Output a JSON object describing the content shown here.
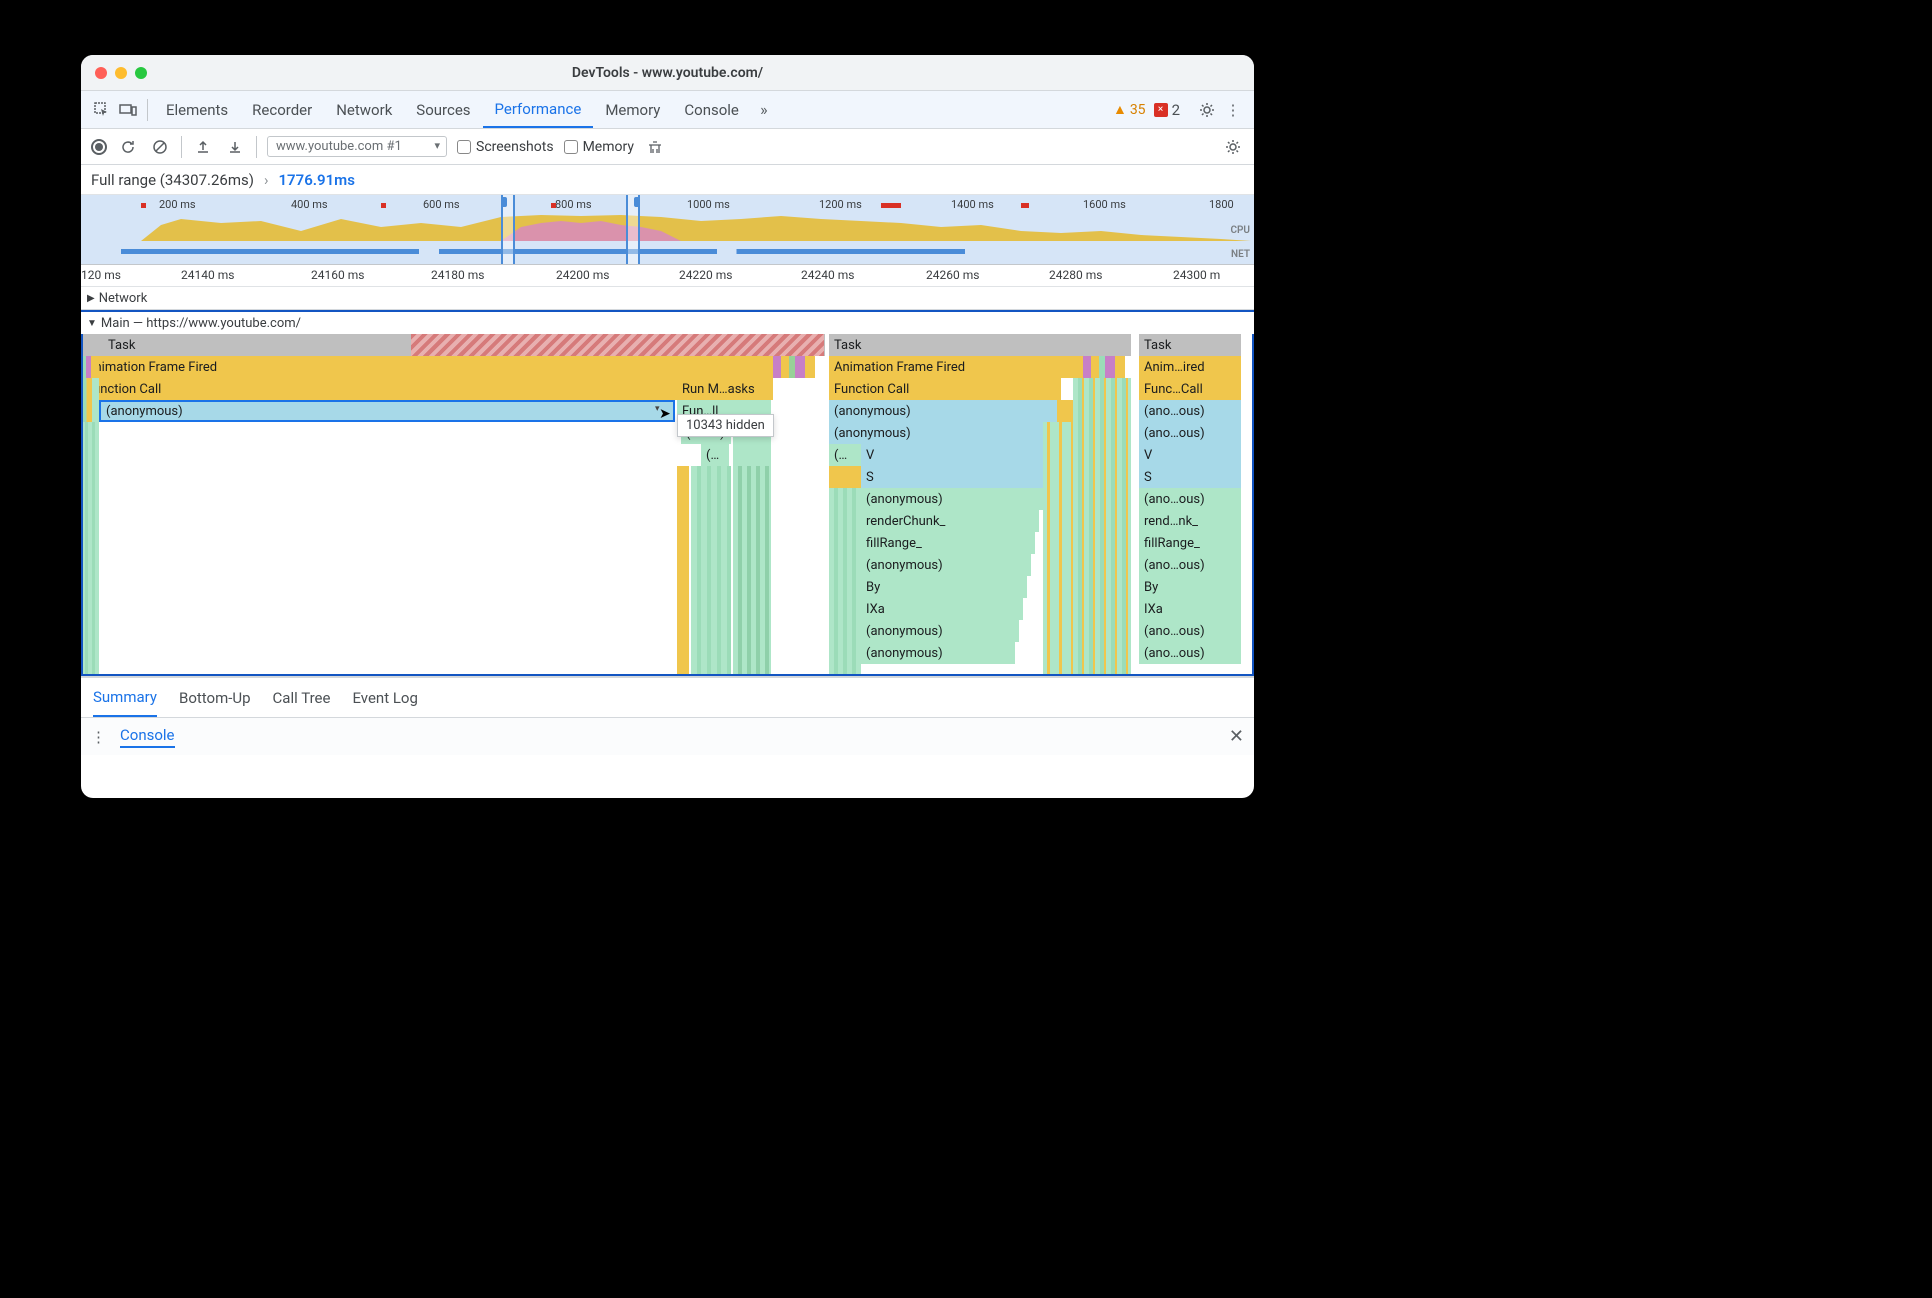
{
  "window": {
    "title": "DevTools - www.youtube.com/"
  },
  "tabs": [
    "Elements",
    "Recorder",
    "Network",
    "Sources",
    "Performance",
    "Memory",
    "Console"
  ],
  "active_tab": "Performance",
  "warnings": "35",
  "errors": "2",
  "subbar": {
    "select": "www.youtube.com #1",
    "screenshots": "Screenshots",
    "memory": "Memory"
  },
  "breadcrumb": {
    "full": "Full range (34307.26ms)",
    "sel": "1776.91ms"
  },
  "overview_ticks": [
    "200 ms",
    "400 ms",
    "600 ms",
    "800 ms",
    "1000 ms",
    "1200 ms",
    "1400 ms",
    "1600 ms",
    "1800"
  ],
  "overview_labels": {
    "cpu": "CPU",
    "net": "NET"
  },
  "ruler_ticks": [
    "120 ms",
    "24140 ms",
    "24160 ms",
    "24180 ms",
    "24200 ms",
    "24220 ms",
    "24240 ms",
    "24260 ms",
    "24280 ms",
    "24300 m"
  ],
  "tracks": {
    "network": "Network",
    "main": "Main — https://www.youtube.com/"
  },
  "flame": {
    "task": "Task",
    "aff": "Animation Frame Fired",
    "fc": "Function Call",
    "anon": "(anonymous)",
    "runm": "Run M…asks",
    "funll": "Fun…ll",
    "ans": "(an…s)",
    "paren": "(…",
    "aff2": "Anim…ired",
    "fc2": "Func…Call",
    "anonous": "(ano…ous)",
    "V": "V",
    "S": "S",
    "renderChunk": "renderChunk_",
    "rendnk": "rend…nk_",
    "fillRange": "fillRange_",
    "By": "By",
    "IXa": "IXa"
  },
  "tooltip": "10343 hidden",
  "tabs2": [
    "Summary",
    "Bottom-Up",
    "Call Tree",
    "Event Log"
  ],
  "active_tab2": "Summary",
  "console": "Console"
}
